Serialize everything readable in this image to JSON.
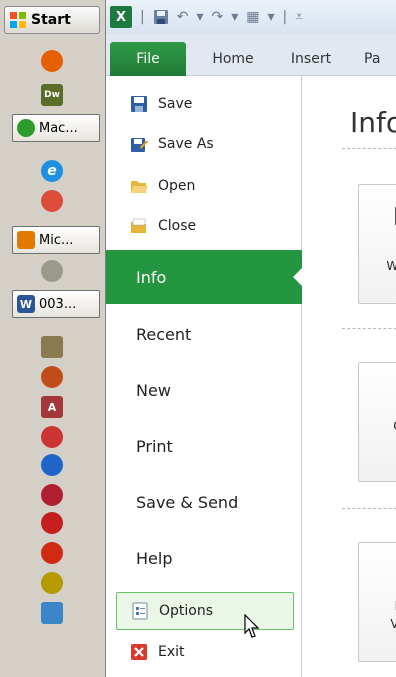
{
  "taskbar": {
    "start_label": "Start",
    "tasks": [
      {
        "label": "Mac...",
        "icon": "dreamweaver-cs-icon",
        "color": "#2a9d2a"
      },
      {
        "label": "Mic...",
        "icon": "office-icon",
        "color": "#e27a00"
      },
      {
        "label": "003...",
        "icon": "word-icon",
        "color": "#2b5797"
      }
    ],
    "quick_icons": [
      {
        "name": "firefox-icon",
        "color": "#e66000"
      },
      {
        "name": "dreamweaver-icon",
        "color": "#5a6e2a",
        "text": "Dw"
      },
      {
        "name": "ie-icon",
        "color": "#1e8fe1",
        "text": "e"
      },
      {
        "name": "chrome-icon",
        "color": "#dd4b39"
      },
      {
        "name": "app-icon-gray",
        "color": "#9a9a8a"
      },
      {
        "name": "bookmark-icon",
        "color": "#8a7a50"
      },
      {
        "name": "matlab-icon",
        "color": "#c24d1a"
      },
      {
        "name": "access-icon",
        "color": "#a4373a",
        "text": "A"
      },
      {
        "name": "app-icon-red",
        "color": "#c33"
      },
      {
        "name": "sync-icon",
        "color": "#1f64c8"
      },
      {
        "name": "opera-icon",
        "color": "#b02030"
      },
      {
        "name": "network-icon",
        "color": "#c41e1e"
      },
      {
        "name": "flash-icon",
        "color": "#d12a12"
      },
      {
        "name": "fluent-icon",
        "color": "#b59a00"
      },
      {
        "name": "recycle-bin-icon",
        "color": "#3a86c8"
      }
    ]
  },
  "qat": {
    "app_icon_text": "X"
  },
  "tabs": [
    {
      "label": "File"
    },
    {
      "label": "Home"
    },
    {
      "label": "Insert"
    },
    {
      "label": "Pa"
    }
  ],
  "backstage": {
    "small_items": [
      {
        "label": "Save",
        "icon": "save-icon"
      },
      {
        "label": "Save As",
        "icon": "save-as-icon"
      },
      {
        "label": "Open",
        "icon": "open-folder-icon"
      },
      {
        "label": "Close",
        "icon": "close-folder-icon"
      }
    ],
    "info_label": "Info",
    "big_items": [
      {
        "label": "Recent"
      },
      {
        "label": "New"
      },
      {
        "label": "Print"
      },
      {
        "label": "Save & Send"
      },
      {
        "label": "Help"
      }
    ],
    "options_label": "Options",
    "exit_label": "Exit"
  },
  "main": {
    "title": "Info",
    "cards": [
      {
        "line1": "P",
        "line2": "Wo"
      },
      {
        "line1": "Cl",
        "line2": "I"
      },
      {
        "line1": "M",
        "line2": "Ve"
      }
    ]
  },
  "colors": {
    "file_tab": "#1f7a35",
    "info_highlight": "#23963f",
    "options_hover_border": "#6cc06c"
  }
}
